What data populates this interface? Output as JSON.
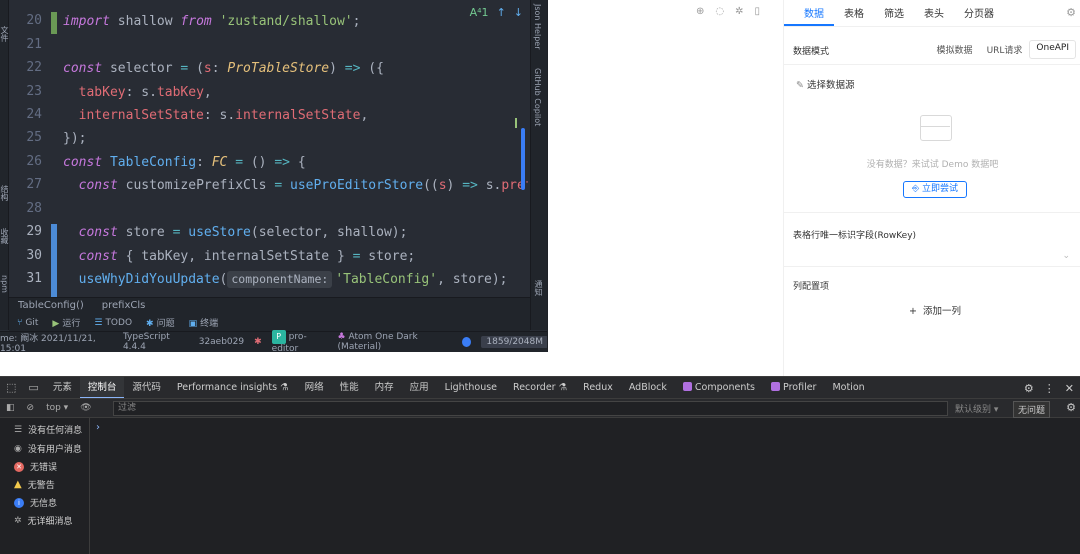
{
  "ide": {
    "left_tags": [
      "文件",
      "结构",
      "收藏",
      "npm"
    ],
    "gutter_lines": [
      "20",
      "21",
      "22",
      "23",
      "24",
      "25",
      "26",
      "27",
      "28",
      "29",
      "30",
      "31"
    ],
    "top_controls": {
      "warn": "A⁴1",
      "up": "↑",
      "down": "↓"
    },
    "right_tools": [
      "Json Helper",
      "GitHub Copilot",
      "通知"
    ],
    "breadcrumb": [
      "TableConfig()",
      "prefixCls"
    ],
    "toolbar": [
      "Git",
      "运行",
      "TODO",
      "问题",
      "终端"
    ],
    "status": {
      "author": "me: 阚冰 2021/11/21, 15:01",
      "ts": "TypeScript 4.4.4",
      "commit": "32aeb029",
      "project_badge": "P",
      "project": "pro-editor",
      "theme": "Atom One Dark (Material)",
      "memory": "1859/2048M"
    }
  },
  "panel": {
    "tabs": [
      "数据",
      "表格",
      "筛选",
      "表头",
      "分页器"
    ],
    "data_mode_label": "数据模式",
    "modes": [
      "模拟数据",
      "URL请求",
      "OneAPI"
    ],
    "pick_source": "选择数据源",
    "empty_text": "没有数据？来试试 Demo 数据吧",
    "try_button": "立即尝试",
    "rowkey_label": "表格行唯一标识字段(RowKey)",
    "columns_label": "列配置项",
    "add_column": "添加一列"
  },
  "devtools": {
    "tabs": [
      "元素",
      "控制台",
      "源代码",
      "Performance insights ⚗",
      "网络",
      "性能",
      "内存",
      "应用",
      "Lighthouse",
      "Recorder ⚗",
      "Redux",
      "AdBlock",
      "Components",
      "Profiler",
      "Motion"
    ],
    "context": "top",
    "filter_placeholder": "过滤",
    "default_levels": "默认级别 ▾",
    "no_issues": "无问题",
    "sidebar": [
      "没有任何消息",
      "没有用户消息",
      "无错误",
      "无警告",
      "无信息",
      "无详细消息"
    ],
    "prompt": "›"
  },
  "colors": {
    "accent": "#1677ff",
    "ide_bg": "#282c34",
    "devtools_bg": "#202124"
  }
}
